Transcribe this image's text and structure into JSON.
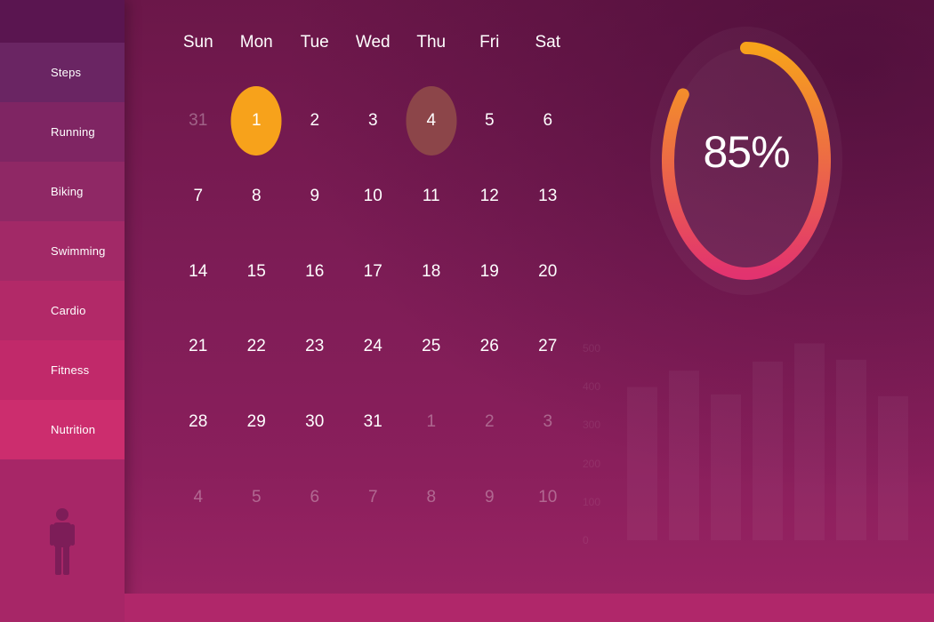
{
  "sidebar": {
    "items": [
      {
        "label": "Steps",
        "color": "#6a2563"
      },
      {
        "label": "Running",
        "color": "#7f2563"
      },
      {
        "label": "Biking",
        "color": "#8f2865"
      },
      {
        "label": "Swimming",
        "color": "#a22967"
      },
      {
        "label": "Cardio",
        "color": "#b22968"
      },
      {
        "label": "Fitness",
        "color": "#c1296a"
      },
      {
        "label": "Nutrition",
        "color": "#cc2d6e"
      }
    ],
    "person_icon": "person-icon"
  },
  "calendar": {
    "weekdays": [
      "Sun",
      "Mon",
      "Tue",
      "Wed",
      "Thu",
      "Fri",
      "Sat"
    ],
    "highlight_colors": {
      "today": "#f7a21b",
      "selected": "#8c4549"
    },
    "days": [
      {
        "label": "31",
        "muted": true
      },
      {
        "label": "1",
        "highlight": "today"
      },
      {
        "label": "2"
      },
      {
        "label": "3"
      },
      {
        "label": "4",
        "highlight": "selected"
      },
      {
        "label": "5"
      },
      {
        "label": "6"
      },
      {
        "label": "7"
      },
      {
        "label": "8"
      },
      {
        "label": "9"
      },
      {
        "label": "10"
      },
      {
        "label": "11"
      },
      {
        "label": "12"
      },
      {
        "label": "13"
      },
      {
        "label": "14"
      },
      {
        "label": "15"
      },
      {
        "label": "16"
      },
      {
        "label": "17"
      },
      {
        "label": "18"
      },
      {
        "label": "19"
      },
      {
        "label": "20"
      },
      {
        "label": "21"
      },
      {
        "label": "22"
      },
      {
        "label": "23"
      },
      {
        "label": "24"
      },
      {
        "label": "25"
      },
      {
        "label": "26"
      },
      {
        "label": "27"
      },
      {
        "label": "28"
      },
      {
        "label": "29"
      },
      {
        "label": "30"
      },
      {
        "label": "31"
      },
      {
        "label": "1",
        "muted": true
      },
      {
        "label": "2",
        "muted": true
      },
      {
        "label": "3",
        "muted": true
      },
      {
        "label": "4",
        "muted": true
      },
      {
        "label": "5",
        "muted": true
      },
      {
        "label": "6",
        "muted": true
      },
      {
        "label": "7",
        "muted": true
      },
      {
        "label": "8",
        "muted": true
      },
      {
        "label": "9",
        "muted": true
      },
      {
        "label": "10",
        "muted": true
      }
    ]
  },
  "progress": {
    "label": "85%",
    "value": 0.85,
    "gradient_start": "#f7a21b",
    "gradient_end": "#e2336f"
  },
  "bar_chart": {
    "y_ticks": [
      "500",
      "400",
      "300",
      "200",
      "100",
      "0"
    ],
    "values": [
      420,
      465,
      400,
      490,
      540,
      495,
      395
    ],
    "ymax": 500
  }
}
